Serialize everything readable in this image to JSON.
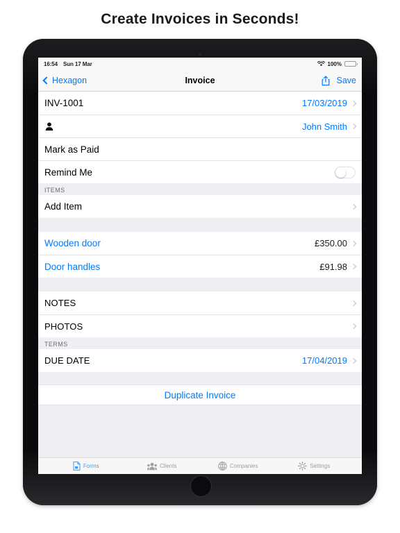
{
  "headline": "Create Invoices in Seconds!",
  "device": {
    "type": "tablet",
    "bezel_color": "#0d0d0f"
  },
  "status_bar": {
    "time": "16:54",
    "date": "Sun 17 Mar",
    "wifi_icon": "wifi-icon",
    "battery_percent": "100%",
    "battery_icon": "battery-full-icon",
    "battery_color": "#4cd964"
  },
  "nav_bar": {
    "back_label": "Hexagon",
    "back_icon": "chevron-left-icon",
    "title": "Invoice",
    "share_icon": "share-icon",
    "save_label": "Save",
    "accent_color": "#007aff"
  },
  "form": {
    "invoice_number_row": {
      "label": "INV-1001",
      "value": "17/03/2019",
      "chevron": "chevron-right-icon"
    },
    "client_row": {
      "icon": "person-icon",
      "value": "John Smith",
      "chevron": "chevron-right-icon"
    },
    "mark_as_paid_row": {
      "label": "Mark as Paid"
    },
    "remind_me_row": {
      "label": "Remind Me",
      "toggle_state": "off"
    },
    "items_section": {
      "header": "ITEMS",
      "add_item_label": "Add Item",
      "items": [
        {
          "name": "Wooden door",
          "amount": "£350.00"
        },
        {
          "name": "Door handles",
          "amount": "£91.98"
        }
      ]
    },
    "notes_row": {
      "label": "NOTES"
    },
    "photos_row": {
      "label": "PHOTOS"
    },
    "terms_section": {
      "header": "TERMS",
      "due_date_label": "DUE DATE",
      "due_date_value": "17/04/2019"
    },
    "duplicate_action": "Duplicate Invoice"
  },
  "tab_bar": {
    "tabs": [
      {
        "label": "Forms",
        "icon": "document-icon",
        "active": true
      },
      {
        "label": "Clients",
        "icon": "people-icon",
        "active": false
      },
      {
        "label": "Companies",
        "icon": "globe-icon",
        "active": false
      },
      {
        "label": "Settings",
        "icon": "gear-icon",
        "active": false
      }
    ],
    "active_color": "#3e9bf5",
    "inactive_color": "#9d9da3"
  }
}
